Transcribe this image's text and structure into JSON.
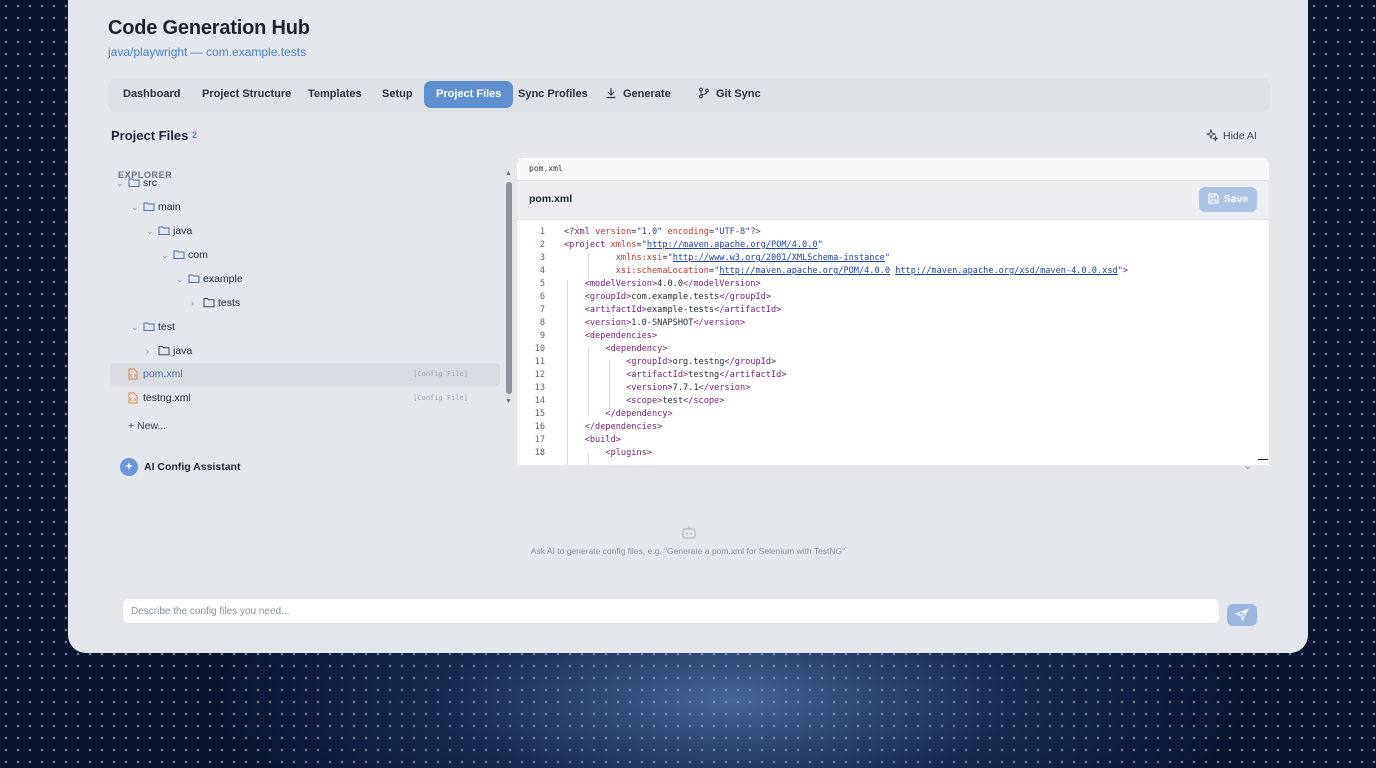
{
  "app": {
    "title": "Code Generation Hub",
    "subtitle": "java/playwright — com.example.tests"
  },
  "tabs": [
    {
      "label": "Dashboard"
    },
    {
      "label": "Project Structure"
    },
    {
      "label": "Templates"
    },
    {
      "label": "Setup"
    },
    {
      "label": "Project Files",
      "active": true
    },
    {
      "label": "Sync Profiles"
    },
    {
      "label": "Generate",
      "icon": "download-icon"
    },
    {
      "label": "Git Sync",
      "icon": "git-branch-icon"
    }
  ],
  "section": {
    "title": "Project Files",
    "count": "2",
    "hide_ai": "Hide AI"
  },
  "explorer": {
    "heading": "EXPLORER",
    "items": [
      {
        "label": "src",
        "type": "folder",
        "expanded": true
      },
      {
        "label": "main",
        "type": "folder",
        "expanded": true
      },
      {
        "label": "java",
        "type": "folder",
        "expanded": true
      },
      {
        "label": "com",
        "type": "folder",
        "expanded": true
      },
      {
        "label": "example",
        "type": "folder",
        "expanded": true
      },
      {
        "label": "tests",
        "type": "folder",
        "expanded": false
      },
      {
        "label": "test",
        "type": "folder",
        "expanded": true
      },
      {
        "label": "java",
        "type": "folder",
        "expanded": false
      },
      {
        "label": "pom.xml",
        "type": "file",
        "tag": "[Config File]",
        "selected": true
      },
      {
        "label": "testng.xml",
        "type": "file",
        "tag": "[Config File]"
      }
    ],
    "new_label": "+ New..."
  },
  "editor": {
    "tab_label": "pom.xml",
    "file_name": "pom.xml",
    "save_label": "Save",
    "line_numbers": [
      "1",
      "2",
      "3",
      "4",
      "5",
      "6",
      "7",
      "8",
      "9",
      "10",
      "11",
      "12",
      "13",
      "14",
      "15",
      "16",
      "17",
      "18"
    ]
  },
  "ai_assistant": {
    "label": "AI Config Assistant",
    "hint": "Ask AI to generate config files, e.g. \"Generate a pom.xml for Selenium with TestNG\"",
    "input_placeholder": "Describe the config files you need..."
  },
  "colors": {
    "accent": "#5f8fcf",
    "panel": "#e3e6ea",
    "link": "#4f7fc8"
  }
}
